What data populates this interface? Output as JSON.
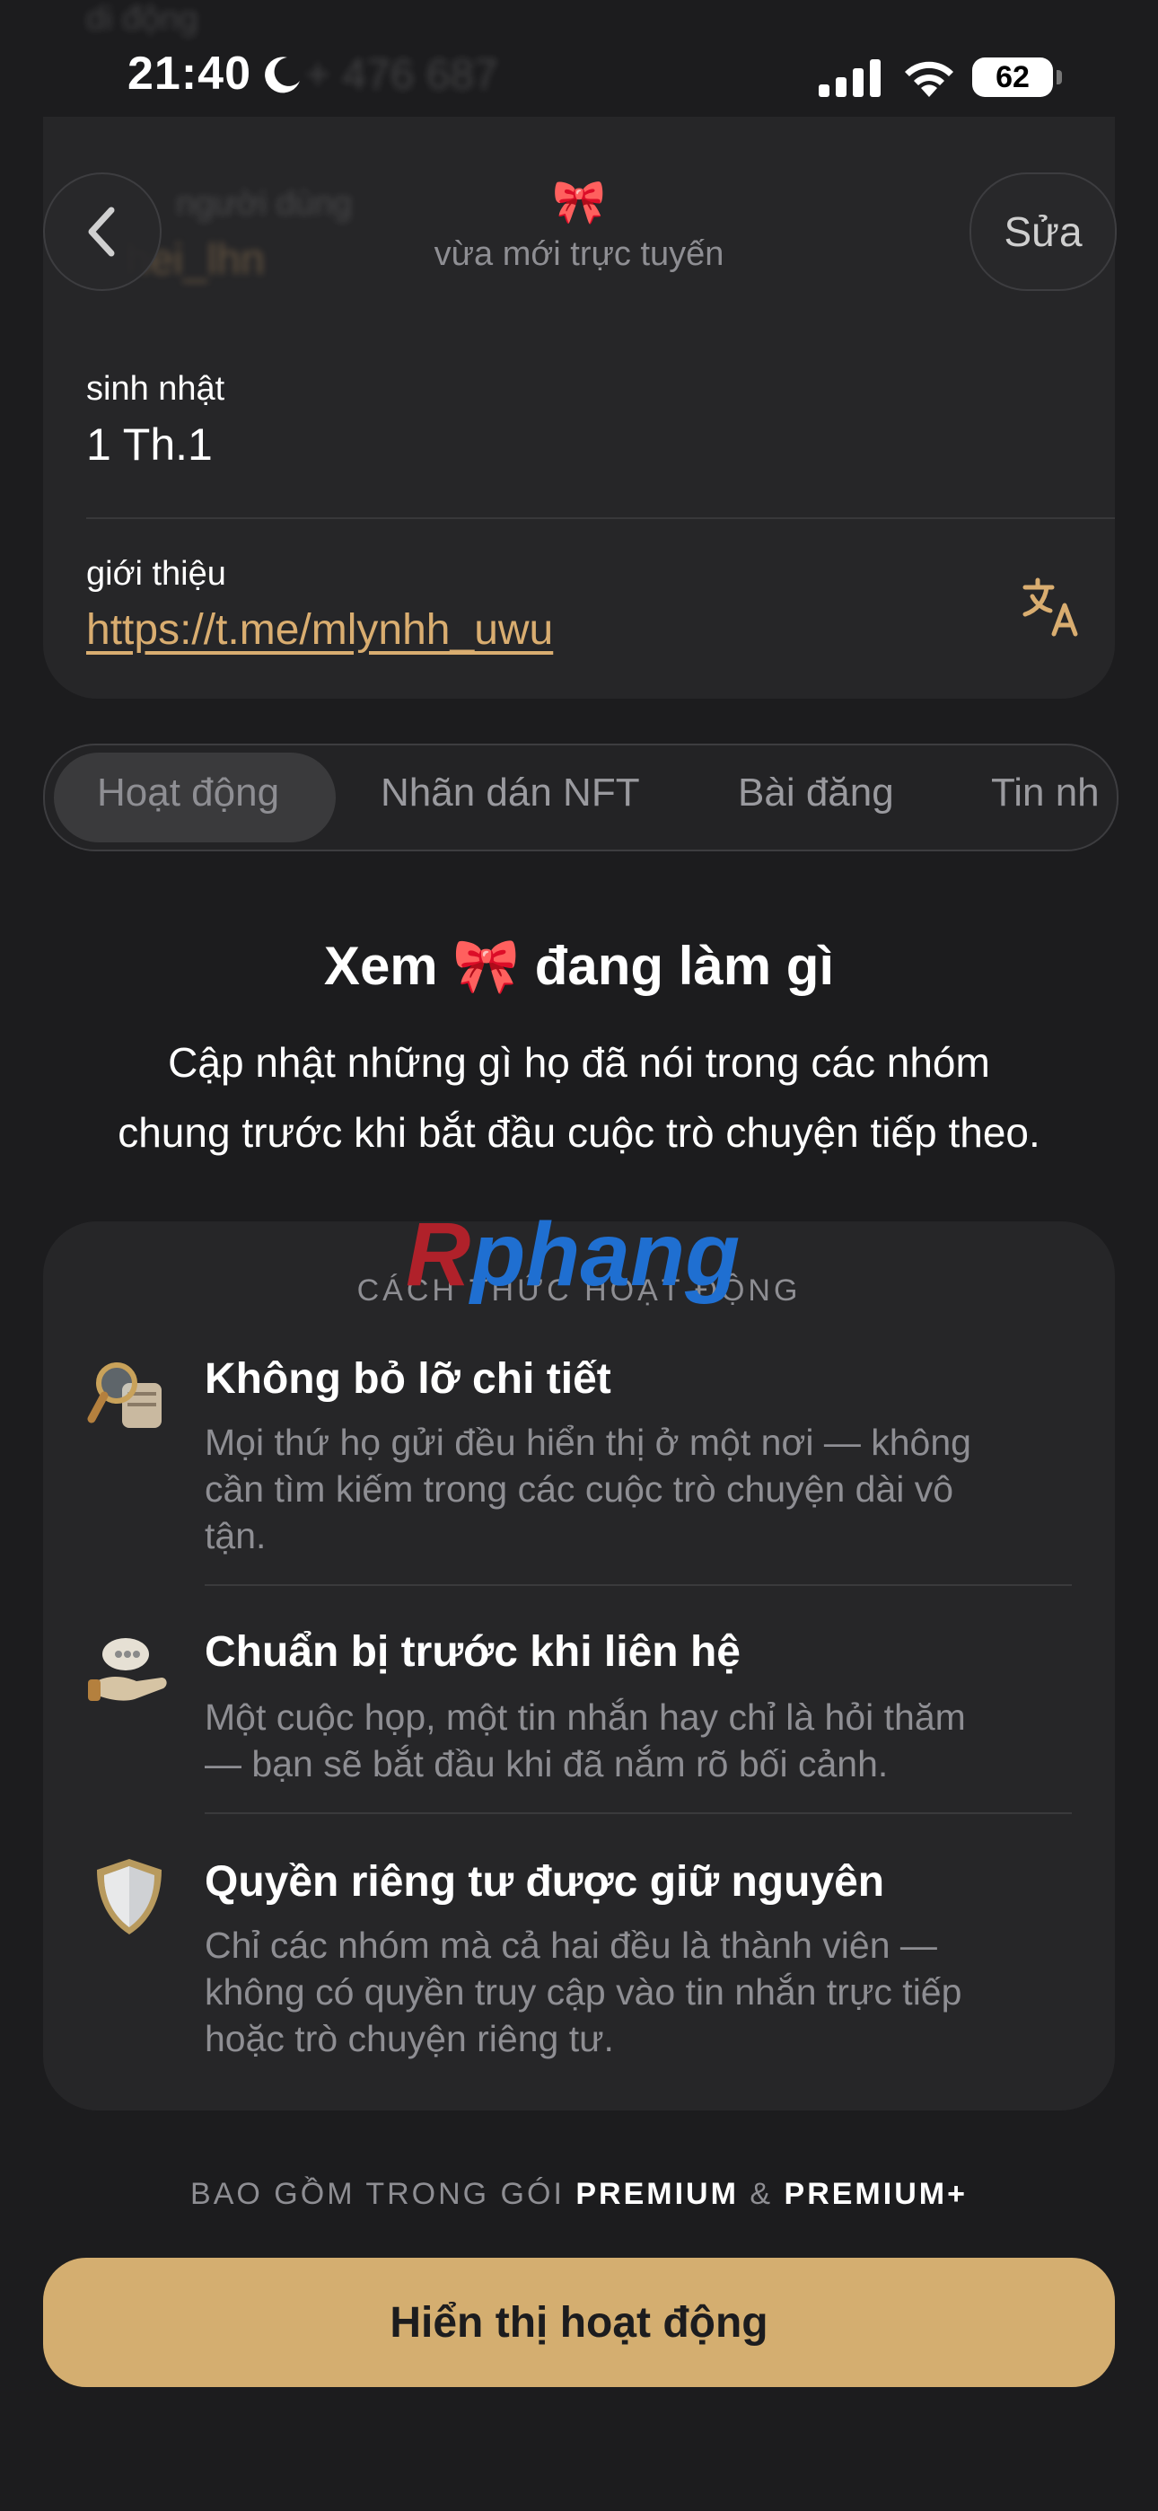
{
  "status_bar": {
    "time": "21:40",
    "battery": "62"
  },
  "background": {
    "phone_fragment": "+ 476 687",
    "phone_label": "di động",
    "username_label": "người dùng",
    "username": "hei_lhn"
  },
  "nav": {
    "emoji": "🎀",
    "status": "vừa mới trực tuyến",
    "edit_label": "Sửa"
  },
  "profile": {
    "birthday_label": "sinh nhật",
    "birthday_value": "1 Th.1",
    "bio_label": "giới thiệu",
    "bio_link": "https://t.me/mlynhh_uwu"
  },
  "tabs": [
    {
      "label": "Hoạt động",
      "active": true
    },
    {
      "label": "Nhãn dán NFT"
    },
    {
      "label": "Bài đăng"
    },
    {
      "label": "Tin nh"
    }
  ],
  "section": {
    "title": "Xem 🎀 đang làm gì",
    "subtitle_line1": "Cập nhật những gì họ đã nói trong các nhóm",
    "subtitle_line2": "chung trước khi bắt đầu cuộc trò chuyện tiếp theo."
  },
  "watermark": {
    "first": "R",
    "rest": "phang"
  },
  "how_it_works": {
    "header": "CÁCH THỨC HOẠT ĐỘNG",
    "items": [
      {
        "icon": "magnifier-icon",
        "title": "Không bỏ lỡ chi tiết",
        "desc_lines": [
          "Mọi thứ họ gửi đều hiển thị ở một nơi — không",
          "cần tìm kiếm trong các cuộc trò chuyện dài vô",
          "tận."
        ]
      },
      {
        "icon": "hand-bubble-icon",
        "title": "Chuẩn bị trước khi liên hệ",
        "desc_lines": [
          "Một cuộc họp, một tin nhắn hay chỉ là hỏi thăm",
          "— bạn sẽ bắt đầu khi đã nắm rõ bối cảnh."
        ]
      },
      {
        "icon": "shield-icon",
        "title": "Quyền riêng tư được giữ nguyên",
        "desc_lines": [
          "Chỉ các nhóm mà cả hai đều là thành viên —",
          "không có quyền truy cập vào tin nhắn trực tiếp",
          "hoặc trò chuyện riêng tư."
        ]
      }
    ]
  },
  "included": {
    "prefix": "BAO GỒM TRONG GÓI",
    "tier1": "PREMIUM",
    "amp": "&",
    "tier2": "PREMIUM+"
  },
  "cta_label": "Hiển thị hoạt động",
  "colors": {
    "accent": "#d4ae70",
    "link": "#d9ad70",
    "background": "#1c1c1e",
    "card": "#262628"
  }
}
